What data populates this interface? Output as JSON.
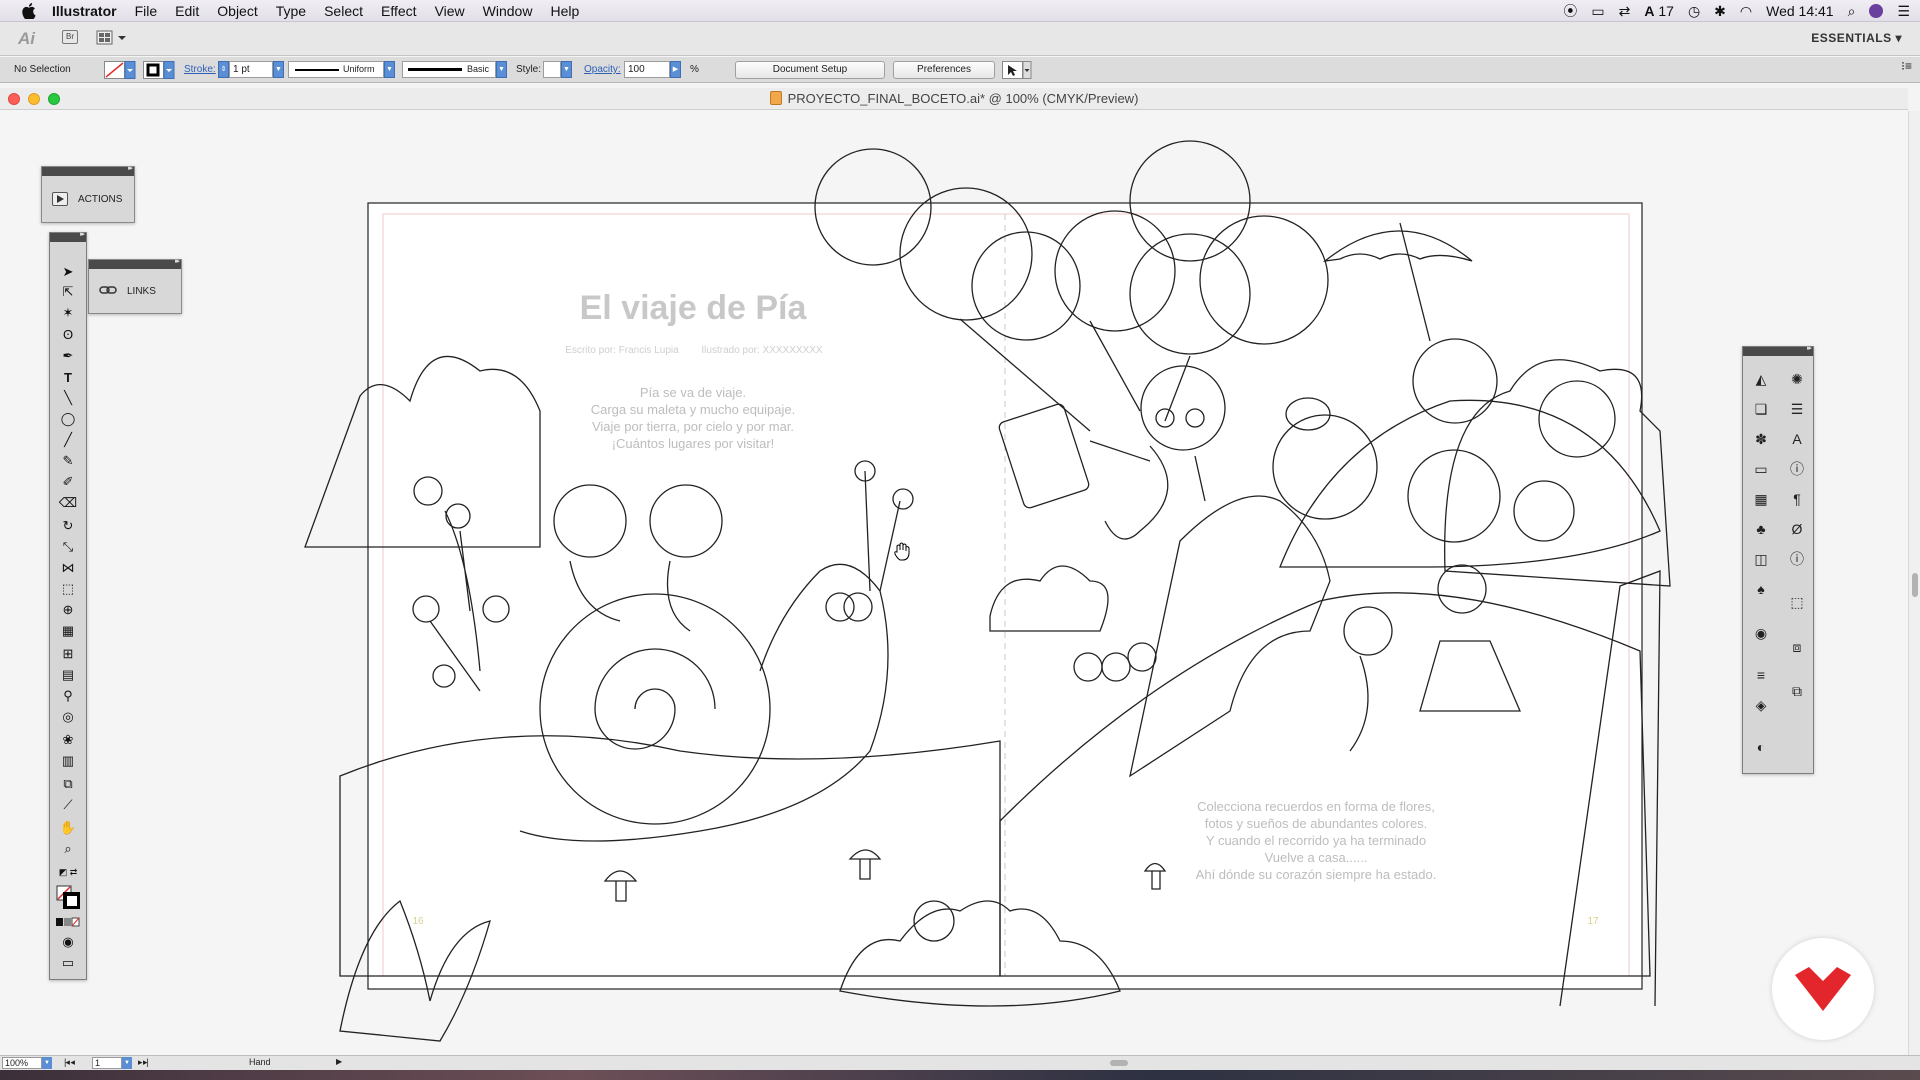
{
  "menubar": {
    "app_name": "Illustrator",
    "items": [
      "File",
      "Edit",
      "Object",
      "Type",
      "Select",
      "Effect",
      "View",
      "Window",
      "Help"
    ],
    "status": {
      "notification_count": "17",
      "clock": "Wed 14:41"
    }
  },
  "appbar": {
    "logo": "Ai",
    "bridge_label": "Br",
    "workspace": "ESSENTIALS ▾"
  },
  "controlbar": {
    "selection": "No Selection",
    "stroke_label": "Stroke:",
    "stroke_value": "1 pt",
    "profile_label": "Uniform",
    "brush_label": "Basic",
    "style_label": "Style:",
    "opacity_label": "Opacity:",
    "opacity_value": "100",
    "opacity_unit": "%",
    "document_setup": "Document Setup",
    "preferences": "Preferences"
  },
  "document": {
    "title": "PROYECTO_FINAL_BOCETO.ai* @ 100% (CMYK/Preview)"
  },
  "panels": {
    "actions_label": "ACTIONS",
    "links_label": "LINKS"
  },
  "artwork": {
    "book_title": "El viaje de Pía",
    "credit_author": "Escrito por: Francis Lupia",
    "credit_illustrator": "Ilustrado por: XXXXXXXXX",
    "left_text": [
      "Pía se va de viaje.",
      "Carga su maleta y mucho equipaje.",
      "Viaje por tierra, por cielo y por mar.",
      "¡Cuántos lugares por visitar!"
    ],
    "right_text": [
      "Colecciona recuerdos en forma de flores,",
      "fotos y sueños de abundantes colores.",
      "Y cuando el recorrido ya ha terminado",
      "Vuelve a casa......",
      "Ahí dónde su corazón siempre ha estado."
    ],
    "page_left": "16",
    "page_right": "17"
  },
  "statusbar": {
    "zoom": "100%",
    "page": "1",
    "tool": "Hand"
  },
  "colors": {
    "accent": "#2c5fb6",
    "brand_badge": "#e3262b",
    "art_stroke": "#222222",
    "sketch_text": "#b8b8b8"
  }
}
